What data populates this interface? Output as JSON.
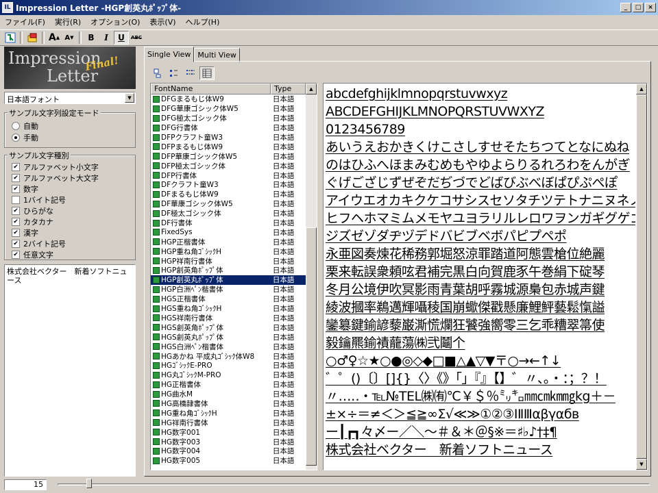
{
  "window": {
    "title": "Impression Letter -HGP創英丸ﾎﾟｯﾌﾟ体-",
    "app_icon": "IL",
    "min": "_",
    "max": "□",
    "close": "×"
  },
  "menu": [
    "ファイル(F)",
    "実行(R)",
    "オプション(O)",
    "表示(V)",
    "ヘルプ(H)"
  ],
  "toolbar": {
    "enlarge": "A",
    "shrink": "A",
    "bold": "B",
    "italic": "I",
    "underline": "U",
    "strike": "ABC"
  },
  "logo": {
    "line1": "Impression",
    "line2": "Letter",
    "badge": "Final!"
  },
  "left": {
    "font_category": "日本語フォント",
    "mode_group": {
      "title": "サンプル文字列設定モード",
      "options": [
        "自動",
        "手動"
      ],
      "selected": "手動"
    },
    "kind_group": {
      "title": "サンプル文字種別",
      "items": [
        {
          "label": "アルファベット小文字",
          "checked": true
        },
        {
          "label": "アルファベット大文字",
          "checked": true
        },
        {
          "label": "数字",
          "checked": true
        },
        {
          "label": "1バイト記号",
          "checked": false
        },
        {
          "label": "ひらがな",
          "checked": true
        },
        {
          "label": "カタカナ",
          "checked": true
        },
        {
          "label": "漢字",
          "checked": true
        },
        {
          "label": "2バイト記号",
          "checked": true
        },
        {
          "label": "任意文字",
          "checked": true
        }
      ]
    },
    "custom_text": "株式会社ベクター　新着ソフトニュース"
  },
  "tabs": [
    "Single View",
    "Multi View"
  ],
  "active_tab": "Single View",
  "font_list": {
    "headers": [
      "FontName",
      "Type"
    ],
    "rows": [
      {
        "name": "DFGまるもじ体W9",
        "type": "日本語"
      },
      {
        "name": "DFG華康ゴシック体W5",
        "type": "日本語"
      },
      {
        "name": "DFG極太ゴシック体",
        "type": "日本語"
      },
      {
        "name": "DFG行書体",
        "type": "日本語"
      },
      {
        "name": "DFPクラフト童W3",
        "type": "日本語"
      },
      {
        "name": "DFPまるもじ体W9",
        "type": "日本語"
      },
      {
        "name": "DFP華康ゴシック体W5",
        "type": "日本語"
      },
      {
        "name": "DFP極太ゴシック体",
        "type": "日本語"
      },
      {
        "name": "DFP行書体",
        "type": "日本語"
      },
      {
        "name": "DFクラフト童W3",
        "type": "日本語"
      },
      {
        "name": "DFまるもじ体W9",
        "type": "日本語"
      },
      {
        "name": "DF華康ゴシック体W5",
        "type": "日本語"
      },
      {
        "name": "DF極太ゴシック体",
        "type": "日本語"
      },
      {
        "name": "DF行書体",
        "type": "日本語"
      },
      {
        "name": "FixedSys",
        "type": "日本語"
      },
      {
        "name": "HGP正楷書体",
        "type": "日本語"
      },
      {
        "name": "HGP重ね角ｺﾞｼｯｸH",
        "type": "日本語"
      },
      {
        "name": "HGP祥南行書体",
        "type": "日本語"
      },
      {
        "name": "HGP創英角ﾎﾟｯﾌﾟ体",
        "type": "日本語"
      },
      {
        "name": "HGP創英丸ﾎﾟｯﾌﾟ体",
        "type": "日本語",
        "selected": true
      },
      {
        "name": "HGP白洲ﾍﾟﾝ楷書体",
        "type": "日本語"
      },
      {
        "name": "HGS正楷書体",
        "type": "日本語"
      },
      {
        "name": "HGS重ね角ｺﾞｼｯｸH",
        "type": "日本語"
      },
      {
        "name": "HGS祥南行書体",
        "type": "日本語"
      },
      {
        "name": "HGS創英角ﾎﾟｯﾌﾟ体",
        "type": "日本語"
      },
      {
        "name": "HGS創英丸ﾎﾟｯﾌﾟ体",
        "type": "日本語"
      },
      {
        "name": "HGS白洲ﾍﾟﾝ楷書体",
        "type": "日本語"
      },
      {
        "name": "HGあかね 平成丸ｺﾞｼｯｸ体W8",
        "type": "日本語"
      },
      {
        "name": "HGｺﾞｼｯｸE-PRO",
        "type": "日本語"
      },
      {
        "name": "HG丸ｺﾞｼｯｸM-PRO",
        "type": "日本語"
      },
      {
        "name": "HG正楷書体",
        "type": "日本語"
      },
      {
        "name": "HG曲水M",
        "type": "日本語"
      },
      {
        "name": "HG高橋隷書体",
        "type": "日本語"
      },
      {
        "name": "HG重ね角ｺﾞｼｯｸH",
        "type": "日本語"
      },
      {
        "name": "HG祥南行書体",
        "type": "日本語"
      },
      {
        "name": "HG数字001",
        "type": "日本語"
      },
      {
        "name": "HG数字003",
        "type": "日本語"
      },
      {
        "name": "HG数字004",
        "type": "日本語"
      },
      {
        "name": "HG数字005",
        "type": "日本語"
      }
    ]
  },
  "preview_lines": [
    "abcdefghijklmnopqrstuvwxyz",
    "ABCDEFGHIJKLMNOPQRSTUVWXYZ",
    "0123456789",
    "あいうえおかきくけこさしすせそたちつてとなにぬね",
    "のはひふへほまみむめもやゆよらりるれろわをんがぎ",
    "ぐげござじずぜぞだぢづでどばびぶべぼぱぴぷぺぽ",
    "アイウエオカキクケコサシスセソタチツテトナニヌネノハ",
    "ヒフヘホマミムメモヤユヨラリルレロワヲンガギグゲゴザ",
    "ジズゼゾダヂヅデドバビブベボパピプペポ",
    "永亜図奏煉花稀務郭堀怒涼罪踏道阿態雲槍位絶麗",
    "栗来転誤衆頼呟君補完黒白向賀鹿豕午巻絹下碇琴",
    "冬月公境伊吹冥影雨青葉胡呼霧城源梟包赤城声鍵",
    "綾波摑率鵜邁輝囁稜国崩蠍傑戳懸廉鯉鮃藝鬆愾謚",
    "鑾簒鍵鍮諺藜巌澌慌爛狂饕強嚮零三乞乖糟翠箒使",
    "毅鑰羆鍮襀蘢蕩㈱弐鬮个",
    "○♂♀☆★○●◎◇◆□■△▲▽▼〒○→←↑↓",
    "゛゜()〔〕[]{}〈〉《》「」『』【】゛〃、。・：；？！",
    "〃…‥・℡№TEL㈱㈲℃￥＄％㍉㌔㎜㎝㎞㎎kg＋－",
    "±×÷＝≠＜＞≦≧∞Σ√≪≫①②③ⅠⅡⅢαβγαбв",
    "ー┃┏┓々〆ー／＼～＃＆＊＠§※＝♯♭♪†‡¶",
    "株式会社ベクター　新着ソフトニュース"
  ],
  "status": {
    "font_size": "15",
    "slider_value": 15
  }
}
